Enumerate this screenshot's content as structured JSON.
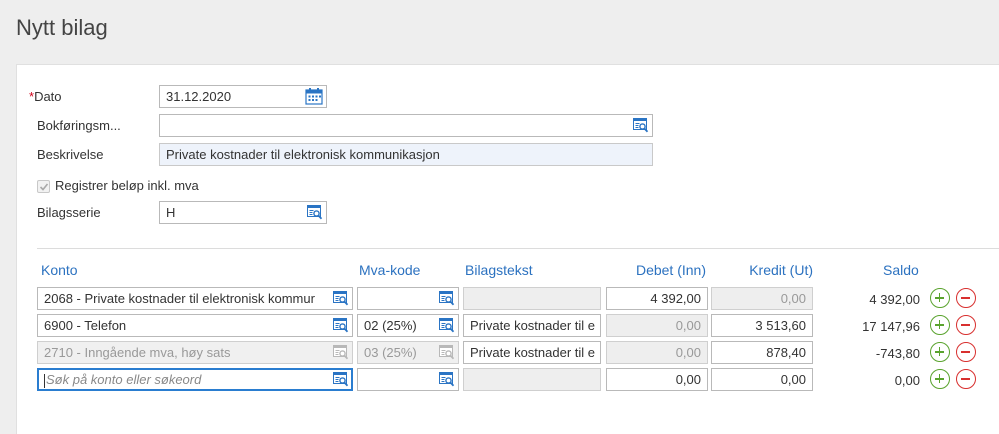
{
  "header": {
    "title": "Nytt bilag"
  },
  "form": {
    "date": {
      "required_mark": "*",
      "label": "Dato",
      "value": "31.12.2020"
    },
    "booking": {
      "label": "Bokføringsm...",
      "value": ""
    },
    "description": {
      "label": "Beskrivelse",
      "value": "Private kostnader til elektronisk kommunikasjon"
    },
    "incl_vat": {
      "label": "Registrer beløp inkl. mva",
      "checked": true
    },
    "series": {
      "label": "Bilagsserie",
      "value": "H"
    }
  },
  "table": {
    "headers": {
      "konto": "Konto",
      "mva": "Mva-kode",
      "bilagstekst": "Bilagstekst",
      "debet": "Debet (Inn)",
      "kredit": "Kredit (Ut)",
      "saldo": "Saldo"
    },
    "rows": [
      {
        "konto": "2068 - Private kostnader til elektronisk kommur",
        "mva": "",
        "tekst": "",
        "debet": "4 392,00",
        "kredit": "0,00",
        "saldo": "4 392,00"
      },
      {
        "konto": "6900 - Telefon",
        "mva": "02 (25%)",
        "tekst": "Private kostnader til e",
        "debet": "0,00",
        "kredit": "3 513,60",
        "saldo": "17 147,96"
      },
      {
        "konto": "2710 - Inngående mva, høy sats",
        "mva": "03 (25%)",
        "tekst": "Private kostnader til e",
        "debet": "0,00",
        "kredit": "878,40",
        "saldo": "-743,80"
      },
      {
        "konto_placeholder": "Søk på konto eller søkeord",
        "mva": "",
        "tekst": "",
        "debet": "0,00",
        "kredit": "0,00",
        "saldo": "0,00"
      }
    ]
  },
  "colors": {
    "accent": "#2c72c0",
    "add": "#5aa32e",
    "remove": "#d8302f"
  }
}
